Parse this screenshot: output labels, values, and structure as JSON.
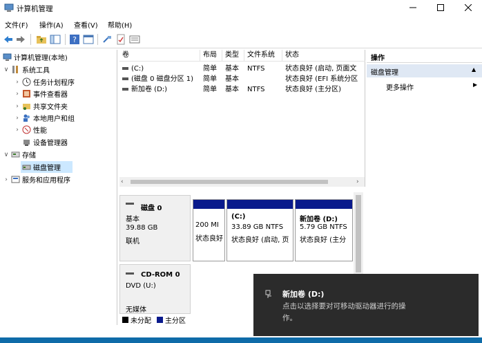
{
  "window": {
    "title": "计算机管理",
    "minimize_icon": "minimize-icon",
    "maximize_icon": "maximize-icon",
    "close_icon": "close-icon"
  },
  "menu": [
    "文件(F)",
    "操作(A)",
    "查看(V)",
    "帮助(H)"
  ],
  "tree": {
    "root": "计算机管理(本地)",
    "system_tools": "系统工具",
    "task_scheduler": "任务计划程序",
    "event_viewer": "事件查看器",
    "shared_folders": "共享文件夹",
    "local_users": "本地用户和组",
    "performance": "性能",
    "device_manager": "设备管理器",
    "storage": "存储",
    "disk_management": "磁盘管理",
    "services_apps": "服务和应用程序"
  },
  "volume_list": {
    "headers": [
      "卷",
      "布局",
      "类型",
      "文件系统",
      "状态"
    ],
    "rows": [
      {
        "name": "(C:)",
        "layout": "简单",
        "type": "基本",
        "fs": "NTFS",
        "status": "状态良好 (启动, 页面文"
      },
      {
        "name": "(磁盘 0 磁盘分区 1)",
        "layout": "简单",
        "type": "基本",
        "fs": "",
        "status": "状态良好 (EFI 系统分区"
      },
      {
        "name": "新加卷 (D:)",
        "layout": "简单",
        "type": "基本",
        "fs": "NTFS",
        "status": "状态良好 (主分区)"
      }
    ]
  },
  "disk0": {
    "label": "磁盘 0",
    "type": "基本",
    "size": "39.88 GB",
    "status": "联机",
    "partitions": [
      {
        "title": "",
        "line1": "200 MI",
        "line2": "状态良好"
      },
      {
        "title": "(C:)",
        "line1": "33.89 GB NTFS",
        "line2": "状态良好 (启动, 页"
      },
      {
        "title": "新加卷  (D:)",
        "line1": "5.79 GB NTFS",
        "line2": "状态良好 (主分"
      }
    ]
  },
  "cdrom": {
    "label": "CD-ROM 0",
    "drive": "DVD (U:)",
    "media": "无媒体"
  },
  "legend": {
    "unallocated": "未分配",
    "primary": "主分区",
    "unallocated_color": "#000000",
    "primary_color": "#0a1a8c"
  },
  "actions": {
    "header": "操作",
    "section": "磁盘管理",
    "more": "更多操作"
  },
  "toast": {
    "title": "新加卷 (D:)",
    "line1": "点击以选择要对可移动驱动器进行的操",
    "line2": "作。"
  }
}
